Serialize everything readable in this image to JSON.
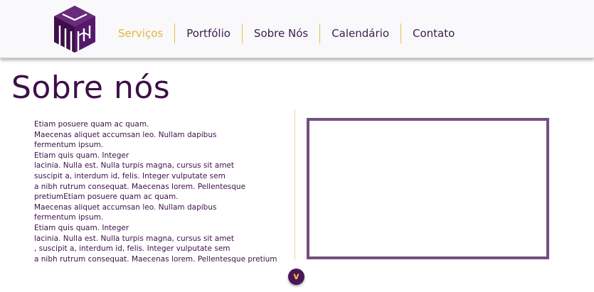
{
  "header": {
    "logo_icon": "stacked-cubes-logo",
    "nav": [
      {
        "label": "Serviços",
        "active": true
      },
      {
        "label": "Portfólio",
        "active": false
      },
      {
        "label": "Sobre Nós",
        "active": false
      },
      {
        "label": "Calendário",
        "active": false
      },
      {
        "label": "Contato",
        "active": false
      }
    ]
  },
  "main": {
    "title": "Sobre nós",
    "body_text": "Etiam posuere quam ac quam.\nMaecenas aliquet accumsan leo. Nullam dapibus\n fermentum ipsum.\n Etiam quis quam. Integer\n lacinia. Nulla est. Nulla turpis magna, cursus sit amet\nsuscipit a, interdum id, felis. Integer vulputate sem\n a nibh rutrum consequat. Maecenas lorem. Pellentesque\npretiumEtiam posuere quam ac quam.\nMaecenas aliquet accumsan leo. Nullam dapibus\n fermentum ipsum.\n Etiam quis quam. Integer\n lacinia. Nulla est. Nulla turpis magna, cursus sit amet\n, suscipit a, interdum id, felis. Integer vulputate sem\n a nibh rutrum consequat. Maecenas lorem. Pellentesque pretium",
    "scroll_button_label": "v"
  },
  "colors": {
    "brand_purple": "#3d1048",
    "accent_gold": "#e0b93a",
    "frame_purple": "#754e7e"
  }
}
